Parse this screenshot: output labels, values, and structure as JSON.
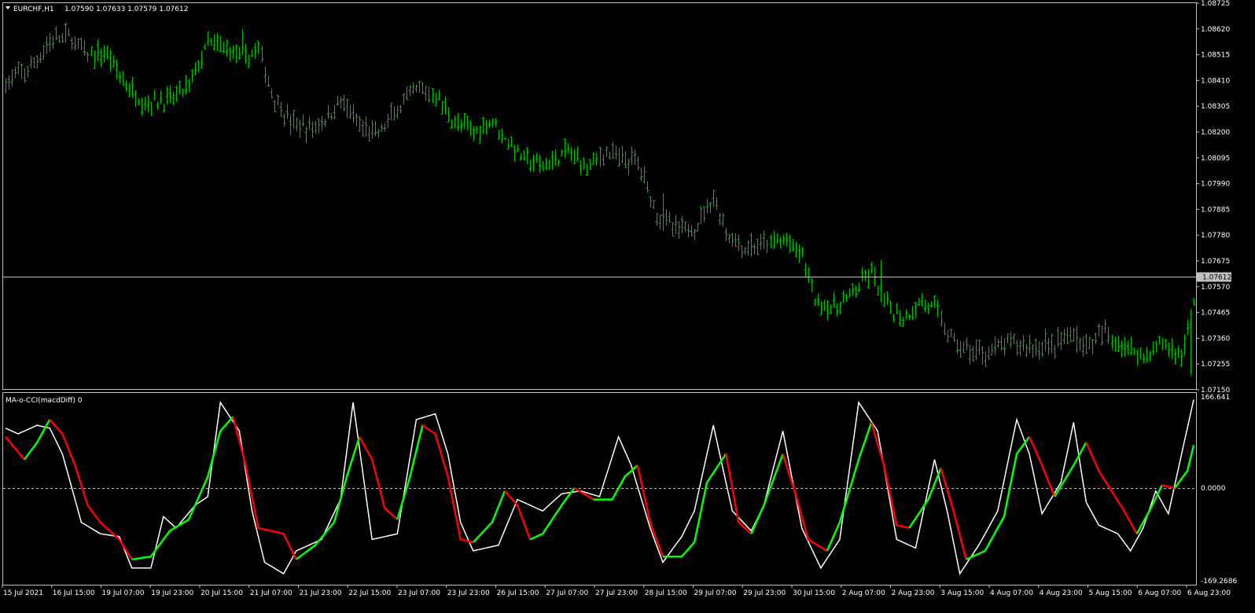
{
  "header": {
    "symbol": "EURCHF,H1",
    "ohlc": "1.07590 1.07633 1.07579 1.07612"
  },
  "indicator": {
    "label": "MA-o-CCI(macdDiff) 0"
  },
  "colors": {
    "background": "#000000",
    "frame": "#c0c0c0",
    "bars": "#00c000",
    "cci_white": "#ffffff",
    "signal_up": "#00ff00",
    "signal_down": "#ff0000",
    "bid_line": "#c0c0c0",
    "zero_line": "#c0c0c0"
  },
  "chart_data": [
    {
      "type": "ohlc",
      "timeframe": "H1",
      "ylim": [
        1.0715,
        1.08725
      ],
      "y_ticks": [
        "1.08725",
        "1.08620",
        "1.08515",
        "1.08410",
        "1.08305",
        "1.08200",
        "1.08095",
        "1.07990",
        "1.07885",
        "1.07780",
        "1.07675",
        "1.07570",
        "1.07465",
        "1.07360",
        "1.07255",
        "1.07150"
      ],
      "current_price": "1.07612",
      "path": [
        [
          0,
          1.084
        ],
        [
          8,
          1.0846
        ],
        [
          14,
          1.0857
        ],
        [
          20,
          1.0859
        ],
        [
          26,
          1.0851
        ],
        [
          32,
          1.0852
        ],
        [
          38,
          1.0839
        ],
        [
          44,
          1.0832
        ],
        [
          52,
          1.0833
        ],
        [
          58,
          1.0839
        ],
        [
          64,
          1.0856
        ],
        [
          70,
          1.0854
        ],
        [
          76,
          1.085
        ],
        [
          80,
          1.0854
        ],
        [
          84,
          1.0836
        ],
        [
          90,
          1.0824
        ],
        [
          96,
          1.0821
        ],
        [
          102,
          1.0826
        ],
        [
          106,
          1.0833
        ],
        [
          112,
          1.0822
        ],
        [
          118,
          1.0819
        ],
        [
          124,
          1.0829
        ],
        [
          130,
          1.0837
        ],
        [
          136,
          1.0835
        ],
        [
          142,
          1.0824
        ],
        [
          148,
          1.082
        ],
        [
          154,
          1.0825
        ],
        [
          158,
          1.0817
        ],
        [
          164,
          1.0809
        ],
        [
          170,
          1.0806
        ],
        [
          178,
          1.0812
        ],
        [
          184,
          1.0806
        ],
        [
          190,
          1.0812
        ],
        [
          194,
          1.0809
        ],
        [
          200,
          1.0808
        ],
        [
          206,
          1.0787
        ],
        [
          212,
          1.078
        ],
        [
          218,
          1.0781
        ],
        [
          224,
          1.0794
        ],
        [
          228,
          1.0779
        ],
        [
          234,
          1.0772
        ],
        [
          240,
          1.0774
        ],
        [
          246,
          1.0776
        ],
        [
          252,
          1.077
        ],
        [
          256,
          1.0752
        ],
        [
          262,
          1.0748
        ],
        [
          268,
          1.0754
        ],
        [
          274,
          1.0763
        ],
        [
          278,
          1.075
        ],
        [
          284,
          1.0744
        ],
        [
          290,
          1.0751
        ],
        [
          294,
          1.0748
        ],
        [
          300,
          1.0734
        ],
        [
          306,
          1.073
        ],
        [
          312,
          1.0731
        ],
        [
          318,
          1.0734
        ],
        [
          324,
          1.0733
        ],
        [
          330,
          1.0732
        ],
        [
          336,
          1.0737
        ],
        [
          342,
          1.0733
        ],
        [
          348,
          1.0738
        ],
        [
          354,
          1.0733
        ],
        [
          360,
          1.0729
        ],
        [
          366,
          1.0734
        ],
        [
          372,
          1.0729
        ],
        [
          376,
          1.075
        ],
        [
          380,
          1.076
        ]
      ],
      "spikes": [
        [
          75,
          1.0862
        ],
        [
          52,
          1.0839
        ],
        [
          128,
          1.0839
        ],
        [
          158,
          1.0817
        ],
        [
          208,
          1.0795
        ],
        [
          236,
          1.0779
        ],
        [
          277,
          1.0768
        ],
        [
          329,
          1.074
        ],
        [
          339,
          1.0741
        ],
        [
          375,
          1.0721
        ]
      ]
    },
    {
      "type": "line",
      "name": "MA-o-CCI(macdDiff)",
      "ylim": [
        -169.2686,
        166.641
      ],
      "y_ticks": [
        "166.641",
        "0.0000",
        "-169.2686"
      ],
      "zero_line": 0,
      "cci_path": [
        [
          0,
          105
        ],
        [
          4,
          95
        ],
        [
          10,
          110
        ],
        [
          14,
          105
        ],
        [
          18,
          60
        ],
        [
          24,
          -60
        ],
        [
          30,
          -80
        ],
        [
          36,
          -85
        ],
        [
          40,
          -140
        ],
        [
          46,
          -140
        ],
        [
          50,
          -50
        ],
        [
          54,
          -70
        ],
        [
          60,
          -30
        ],
        [
          64,
          -15
        ],
        [
          68,
          150
        ],
        [
          74,
          100
        ],
        [
          78,
          -40
        ],
        [
          82,
          -130
        ],
        [
          88,
          -150
        ],
        [
          92,
          -110
        ],
        [
          100,
          -90
        ],
        [
          106,
          -20
        ],
        [
          110,
          150
        ],
        [
          116,
          -90
        ],
        [
          124,
          -80
        ],
        [
          130,
          120
        ],
        [
          136,
          130
        ],
        [
          140,
          60
        ],
        [
          144,
          -60
        ],
        [
          148,
          -110
        ],
        [
          156,
          -100
        ],
        [
          162,
          -20
        ],
        [
          170,
          -40
        ],
        [
          176,
          -10
        ],
        [
          182,
          -5
        ],
        [
          188,
          -15
        ],
        [
          194,
          90
        ],
        [
          198,
          40
        ],
        [
          204,
          -70
        ],
        [
          208,
          -130
        ],
        [
          214,
          -85
        ],
        [
          218,
          -40
        ],
        [
          224,
          110
        ],
        [
          230,
          -40
        ],
        [
          236,
          -75
        ],
        [
          240,
          -30
        ],
        [
          246,
          100
        ],
        [
          252,
          -70
        ],
        [
          258,
          -140
        ],
        [
          264,
          -90
        ],
        [
          270,
          150
        ],
        [
          276,
          100
        ],
        [
          282,
          -90
        ],
        [
          288,
          -105
        ],
        [
          294,
          50
        ],
        [
          298,
          -40
        ],
        [
          302,
          -150
        ],
        [
          308,
          -100
        ],
        [
          314,
          -40
        ],
        [
          320,
          120
        ],
        [
          324,
          60
        ],
        [
          328,
          -45
        ],
        [
          334,
          10
        ],
        [
          338,
          115
        ],
        [
          342,
          -25
        ],
        [
          346,
          -65
        ],
        [
          352,
          -80
        ],
        [
          356,
          -110
        ],
        [
          360,
          -70
        ],
        [
          364,
          -5
        ],
        [
          368,
          -45
        ],
        [
          372,
          55
        ],
        [
          376,
          155
        ]
      ],
      "signal_path": [
        [
          0,
          90
        ],
        [
          6,
          50
        ],
        [
          10,
          80
        ],
        [
          14,
          120
        ],
        [
          18,
          95
        ],
        [
          22,
          40
        ],
        [
          26,
          -30
        ],
        [
          30,
          -60
        ],
        [
          36,
          -90
        ],
        [
          40,
          -125
        ],
        [
          46,
          -120
        ],
        [
          52,
          -75
        ],
        [
          58,
          -55
        ],
        [
          64,
          20
        ],
        [
          68,
          100
        ],
        [
          72,
          125
        ],
        [
          76,
          40
        ],
        [
          80,
          -70
        ],
        [
          84,
          -75
        ],
        [
          88,
          -80
        ],
        [
          92,
          -125
        ],
        [
          98,
          -100
        ],
        [
          104,
          -60
        ],
        [
          108,
          20
        ],
        [
          112,
          90
        ],
        [
          116,
          50
        ],
        [
          120,
          -35
        ],
        [
          124,
          -55
        ],
        [
          128,
          20
        ],
        [
          132,
          110
        ],
        [
          136,
          95
        ],
        [
          140,
          20
        ],
        [
          144,
          -90
        ],
        [
          148,
          -95
        ],
        [
          154,
          -60
        ],
        [
          158,
          -5
        ],
        [
          162,
          -30
        ],
        [
          166,
          -90
        ],
        [
          170,
          -80
        ],
        [
          176,
          -30
        ],
        [
          180,
          0
        ],
        [
          186,
          -20
        ],
        [
          192,
          -20
        ],
        [
          196,
          20
        ],
        [
          200,
          40
        ],
        [
          204,
          -60
        ],
        [
          208,
          -120
        ],
        [
          214,
          -120
        ],
        [
          218,
          -95
        ],
        [
          222,
          10
        ],
        [
          228,
          60
        ],
        [
          232,
          -60
        ],
        [
          236,
          -80
        ],
        [
          240,
          -30
        ],
        [
          246,
          60
        ],
        [
          250,
          -10
        ],
        [
          254,
          -90
        ],
        [
          260,
          -110
        ],
        [
          264,
          -60
        ],
        [
          270,
          50
        ],
        [
          274,
          115
        ],
        [
          278,
          40
        ],
        [
          282,
          -65
        ],
        [
          286,
          -70
        ],
        [
          292,
          -20
        ],
        [
          296,
          35
        ],
        [
          300,
          -40
        ],
        [
          304,
          -125
        ],
        [
          310,
          -110
        ],
        [
          316,
          -50
        ],
        [
          320,
          60
        ],
        [
          324,
          90
        ],
        [
          328,
          40
        ],
        [
          332,
          -15
        ],
        [
          338,
          40
        ],
        [
          342,
          80
        ],
        [
          346,
          30
        ],
        [
          350,
          -5
        ],
        [
          354,
          -40
        ],
        [
          358,
          -80
        ],
        [
          362,
          -40
        ],
        [
          366,
          5
        ],
        [
          370,
          0
        ],
        [
          374,
          30
        ],
        [
          376,
          75
        ]
      ]
    }
  ],
  "x_axis": {
    "labels": [
      "15 Jul 2021",
      "16 Jul 15:00",
      "19 Jul 07:00",
      "19 Jul 23:00",
      "20 Jul 15:00",
      "21 Jul 07:00",
      "21 Jul 23:00",
      "22 Jul 15:00",
      "23 Jul 07:00",
      "23 Jul 23:00",
      "26 Jul 15:00",
      "27 Jul 07:00",
      "27 Jul 23:00",
      "28 Jul 15:00",
      "29 Jul 07:00",
      "29 Jul 23:00",
      "30 Jul 15:00",
      "2 Aug 07:00",
      "2 Aug 23:00",
      "3 Aug 15:00",
      "4 Aug 07:00",
      "4 Aug 23:00",
      "5 Aug 15:00",
      "6 Aug 07:00",
      "6 Aug 23:00"
    ]
  }
}
